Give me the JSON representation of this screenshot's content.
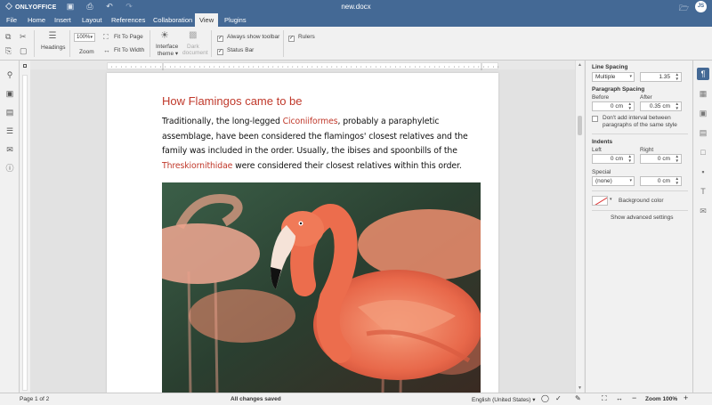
{
  "app": {
    "brand": "ONLYOFFICE",
    "doc_title": "new.docx",
    "user_initials": "JS"
  },
  "menu": {
    "tabs": [
      "File",
      "Home",
      "Insert",
      "Layout",
      "References",
      "Collaboration",
      "View",
      "Plugins"
    ],
    "active_tab": "View"
  },
  "ribbon": {
    "headings": "Headings",
    "zoom_value": "100%",
    "zoom_label": "Zoom",
    "fit_page": "Fit To Page",
    "fit_width": "Fit To Width",
    "interface_theme_l1": "Interface",
    "interface_theme_l2": "theme",
    "dark_doc_l1": "Dark",
    "dark_doc_l2": "document",
    "always_show_toolbar": "Always show toolbar",
    "status_bar": "Status Bar",
    "rulers": "Rulers"
  },
  "document": {
    "heading": "How Flamingos came to be",
    "para_1": "Traditionally, the long-legged ",
    "link_1": "Ciconiiformes",
    "para_2": ", probably a paraphyletic assemblage, have been considered the flamingos' closest relatives and the family was included in the order. Usually, the ibises and spoonbills of the ",
    "link_2": "Threskiornithidae",
    "para_3": " were considered their closest relatives within this order."
  },
  "panel": {
    "line_spacing": "Line Spacing",
    "line_spacing_type": "Multiple",
    "line_spacing_value": "1.35",
    "paragraph_spacing": "Paragraph Spacing",
    "before_label": "Before",
    "after_label": "After",
    "before_value": "0 cm",
    "after_value": "0.35 cm",
    "dont_add_interval": "Don't add interval between paragraphs of the same style",
    "indents": "Indents",
    "left_label": "Left",
    "right_label": "Right",
    "left_value": "0 cm",
    "right_value": "0 cm",
    "special_label": "Special",
    "special_value": "(none)",
    "special_amount": "0 cm",
    "background_color": "Background color",
    "advanced": "Show advanced settings"
  },
  "status": {
    "page": "Page 1 of 2",
    "saved": "All changes saved",
    "language": "English (United States)",
    "zoom": "Zoom 100%"
  },
  "colors": {
    "brand": "#446995",
    "heading_red": "#c0392b"
  },
  "icons": {
    "left_sidebar": [
      "search-icon",
      "comments-icon",
      "chat-icon",
      "navigation-icon",
      "feedback-icon",
      "about-icon"
    ],
    "right_strip": [
      "paragraph-icon",
      "table-icon",
      "image-icon",
      "header-footer-icon",
      "shape-icon",
      "chart-icon",
      "textart-icon",
      "mail-merge-icon"
    ]
  }
}
